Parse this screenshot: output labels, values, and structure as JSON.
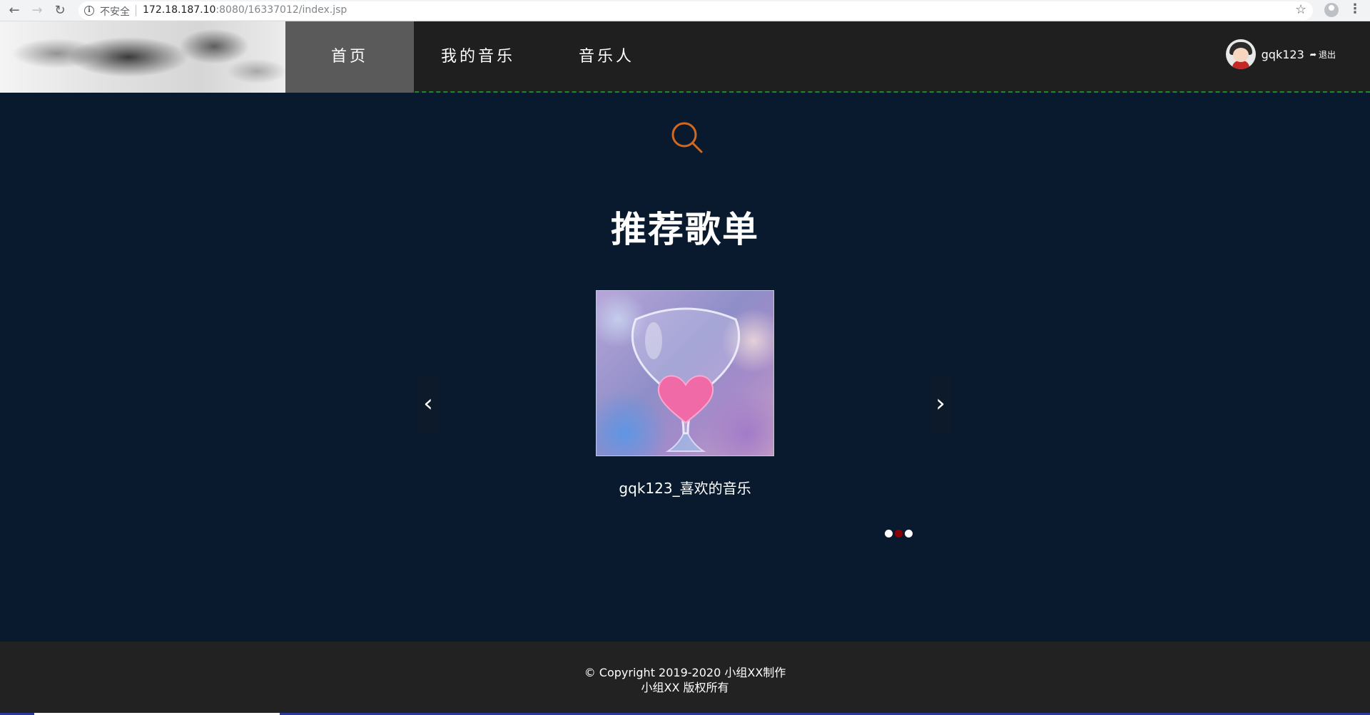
{
  "browser": {
    "insecure_label": "不安全",
    "url_host": "172.18.187.10",
    "url_rest": ":8080/16337012/index.jsp",
    "icons": [
      "back-icon",
      "forward-icon",
      "reload-icon",
      "info-icon",
      "star-icon",
      "profile-icon",
      "menu-icon"
    ]
  },
  "header": {
    "nav": [
      "首页",
      "我的音乐",
      "音乐人"
    ],
    "active_index": 0,
    "username": "gqk123",
    "logout_label": "退出",
    "border_color": "#1a8a2a"
  },
  "main": {
    "title": "推荐歌单",
    "playlist_caption": "gqk123_喜欢的音乐",
    "carousel": {
      "slides": 3,
      "active_slide": 1
    },
    "search_icon_color": "#d2691e"
  },
  "footer": {
    "copyright": "© Copyright 2019-2020 小组XX制作",
    "rights": "小组XX 版权所有"
  }
}
